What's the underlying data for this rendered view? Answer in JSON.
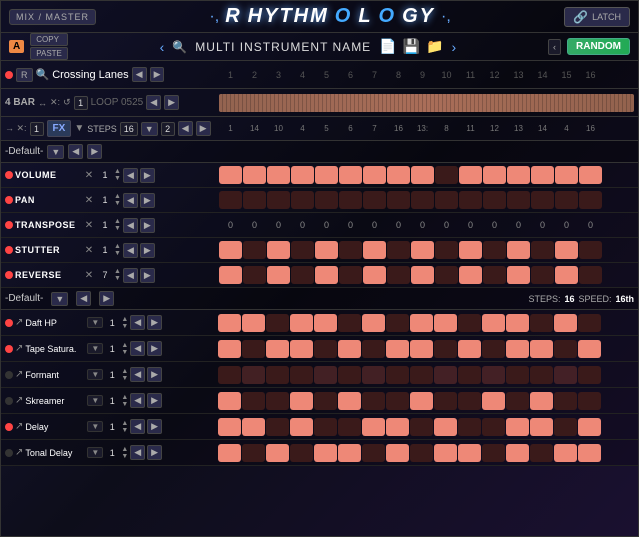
{
  "topbar": {
    "mix_master": "MIX / MASTER",
    "title": "·,RHYTHMOLOGY·,",
    "latch": "LATCH"
  },
  "secondbar": {
    "badge": "A",
    "copy": "COPY",
    "paste": "PASTE",
    "instrument_name": "MULTI INSTRUMENT NAME",
    "random": "RANDOM"
  },
  "crossing": {
    "preset_name": "Crossing Lanes",
    "step_numbers": [
      "1",
      "2",
      "3",
      "4",
      "5",
      "6",
      "7",
      "8",
      "9",
      "10",
      "11",
      "12",
      "13",
      "14",
      "15",
      "16"
    ]
  },
  "loop": {
    "bar_label": "4 BAR",
    "loop_name": "LOOP 0525"
  },
  "steps_row": {
    "label": "STEPS",
    "value": "16",
    "beat_val": "2",
    "cell_values": [
      "1",
      "14",
      "10",
      "4",
      "5",
      "6",
      "7",
      "16",
      "13:",
      "8",
      "11",
      "12",
      "13",
      "14",
      "4",
      "16"
    ]
  },
  "section1": {
    "title": "-Default-"
  },
  "params": [
    {
      "name": "VOLUME",
      "val": "1",
      "pattern": [
        1,
        1,
        1,
        0,
        1,
        0,
        1,
        0,
        1,
        0,
        1,
        0,
        1,
        0,
        1,
        0
      ]
    },
    {
      "name": "PAN",
      "val": "1",
      "pattern": [
        0,
        0,
        0,
        0,
        0,
        0,
        0,
        0,
        0,
        0,
        0,
        0,
        0,
        0,
        0,
        0
      ]
    },
    {
      "name": "TRANSPOSE",
      "val": "1",
      "pattern": [
        0,
        0,
        0,
        0,
        0,
        0,
        0,
        0,
        0,
        0,
        0,
        0,
        0,
        0,
        0,
        0
      ],
      "numeric": true,
      "nums": [
        "0",
        "0",
        "0",
        "0",
        "0",
        "0",
        "0",
        "0",
        "0",
        "0",
        "0",
        "0",
        "0",
        "0",
        "0",
        "0"
      ]
    },
    {
      "name": "STUTTER",
      "val": "1",
      "pattern": [
        1,
        0,
        1,
        0,
        1,
        0,
        1,
        0,
        1,
        0,
        1,
        0,
        1,
        0,
        1,
        0
      ]
    },
    {
      "name": "REVERSE",
      "val": "7",
      "pattern": [
        1,
        0,
        1,
        0,
        1,
        0,
        1,
        0,
        1,
        0,
        1,
        0,
        1,
        0,
        1,
        0
      ]
    }
  ],
  "section2": {
    "title": "-Default-",
    "steps_label": "STEPS:",
    "steps_val": "16",
    "speed_label": "SPEED:",
    "speed_val": "16th"
  },
  "instruments": [
    {
      "name": "Daft HP",
      "val": "1",
      "pattern": [
        1,
        1,
        0,
        1,
        1,
        0,
        1,
        0,
        1,
        1,
        0,
        1,
        1,
        0,
        1,
        0
      ]
    },
    {
      "name": "Tape Satura.",
      "val": "1",
      "pattern": [
        1,
        0,
        1,
        1,
        0,
        1,
        0,
        1,
        1,
        0,
        1,
        0,
        1,
        1,
        0,
        1
      ]
    },
    {
      "name": "Formant",
      "val": "1",
      "pattern": [
        0,
        1,
        0,
        0,
        1,
        0,
        1,
        0,
        0,
        1,
        0,
        1,
        0,
        0,
        1,
        0
      ]
    },
    {
      "name": "Skreamer",
      "val": "1",
      "pattern": [
        1,
        0,
        0,
        1,
        0,
        1,
        0,
        0,
        1,
        0,
        0,
        1,
        0,
        1,
        0,
        0
      ]
    },
    {
      "name": "Delay",
      "val": "1",
      "pattern": [
        1,
        1,
        0,
        1,
        0,
        0,
        1,
        1,
        0,
        1,
        0,
        0,
        1,
        1,
        0,
        1
      ]
    },
    {
      "name": "Tonal Delay",
      "val": "1",
      "pattern": [
        1,
        0,
        1,
        0,
        1,
        1,
        0,
        1,
        0,
        1,
        1,
        0,
        1,
        0,
        1,
        1
      ]
    }
  ]
}
